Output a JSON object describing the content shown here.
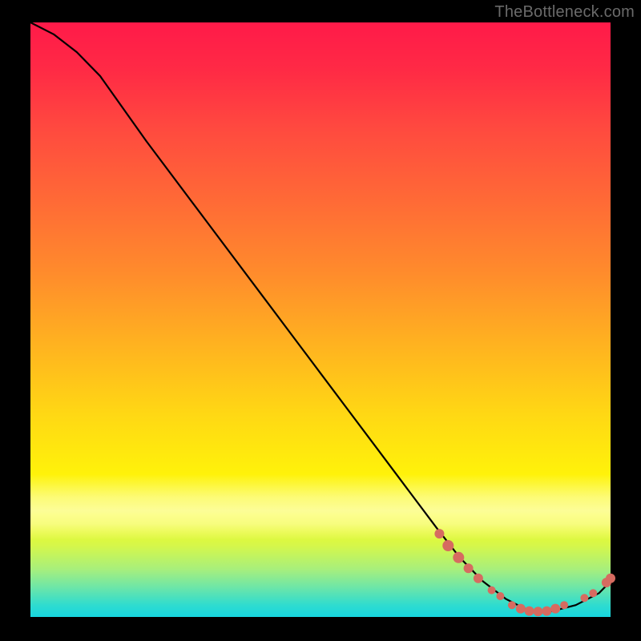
{
  "attribution": "TheBottleneck.com",
  "chart_data": {
    "type": "line",
    "title": "",
    "xlabel": "",
    "ylabel": "",
    "xlim": [
      0,
      100
    ],
    "ylim": [
      0,
      100
    ],
    "series": [
      {
        "name": "bottleneck-curve",
        "x": [
          0,
          4,
          8,
          12,
          20,
          30,
          40,
          50,
          60,
          70,
          74,
          78,
          82,
          86,
          90,
          94,
          98,
          100
        ],
        "y": [
          100,
          98,
          95,
          91,
          80,
          67,
          54,
          41,
          28,
          15,
          10,
          6,
          3,
          1,
          1,
          2,
          4,
          6
        ]
      }
    ],
    "markers": [
      {
        "name": "cluster-a",
        "x": 70.5,
        "y": 14.0,
        "r": 6
      },
      {
        "name": "cluster-a",
        "x": 72.0,
        "y": 12.0,
        "r": 7
      },
      {
        "name": "cluster-a",
        "x": 73.8,
        "y": 10.0,
        "r": 7
      },
      {
        "name": "cluster-a",
        "x": 75.5,
        "y": 8.2,
        "r": 6
      },
      {
        "name": "cluster-a",
        "x": 77.2,
        "y": 6.5,
        "r": 6
      },
      {
        "name": "gap-1",
        "x": 79.5,
        "y": 4.5,
        "r": 5
      },
      {
        "name": "gap-1",
        "x": 81.0,
        "y": 3.5,
        "r": 5
      },
      {
        "name": "cluster-b",
        "x": 83.0,
        "y": 2.0,
        "r": 5
      },
      {
        "name": "cluster-b",
        "x": 84.5,
        "y": 1.4,
        "r": 6
      },
      {
        "name": "cluster-b",
        "x": 86.0,
        "y": 1.0,
        "r": 6
      },
      {
        "name": "cluster-b",
        "x": 87.5,
        "y": 0.9,
        "r": 6
      },
      {
        "name": "cluster-b",
        "x": 89.0,
        "y": 1.0,
        "r": 6
      },
      {
        "name": "cluster-b",
        "x": 90.5,
        "y": 1.4,
        "r": 6
      },
      {
        "name": "cluster-b",
        "x": 92.0,
        "y": 2.0,
        "r": 5
      },
      {
        "name": "tail",
        "x": 95.5,
        "y": 3.2,
        "r": 5
      },
      {
        "name": "tail",
        "x": 97.0,
        "y": 4.0,
        "r": 5
      },
      {
        "name": "end",
        "x": 99.3,
        "y": 5.8,
        "r": 6
      },
      {
        "name": "end",
        "x": 100.0,
        "y": 6.5,
        "r": 6
      }
    ],
    "marker_color": "#d66b60",
    "line_color": "#000000"
  }
}
